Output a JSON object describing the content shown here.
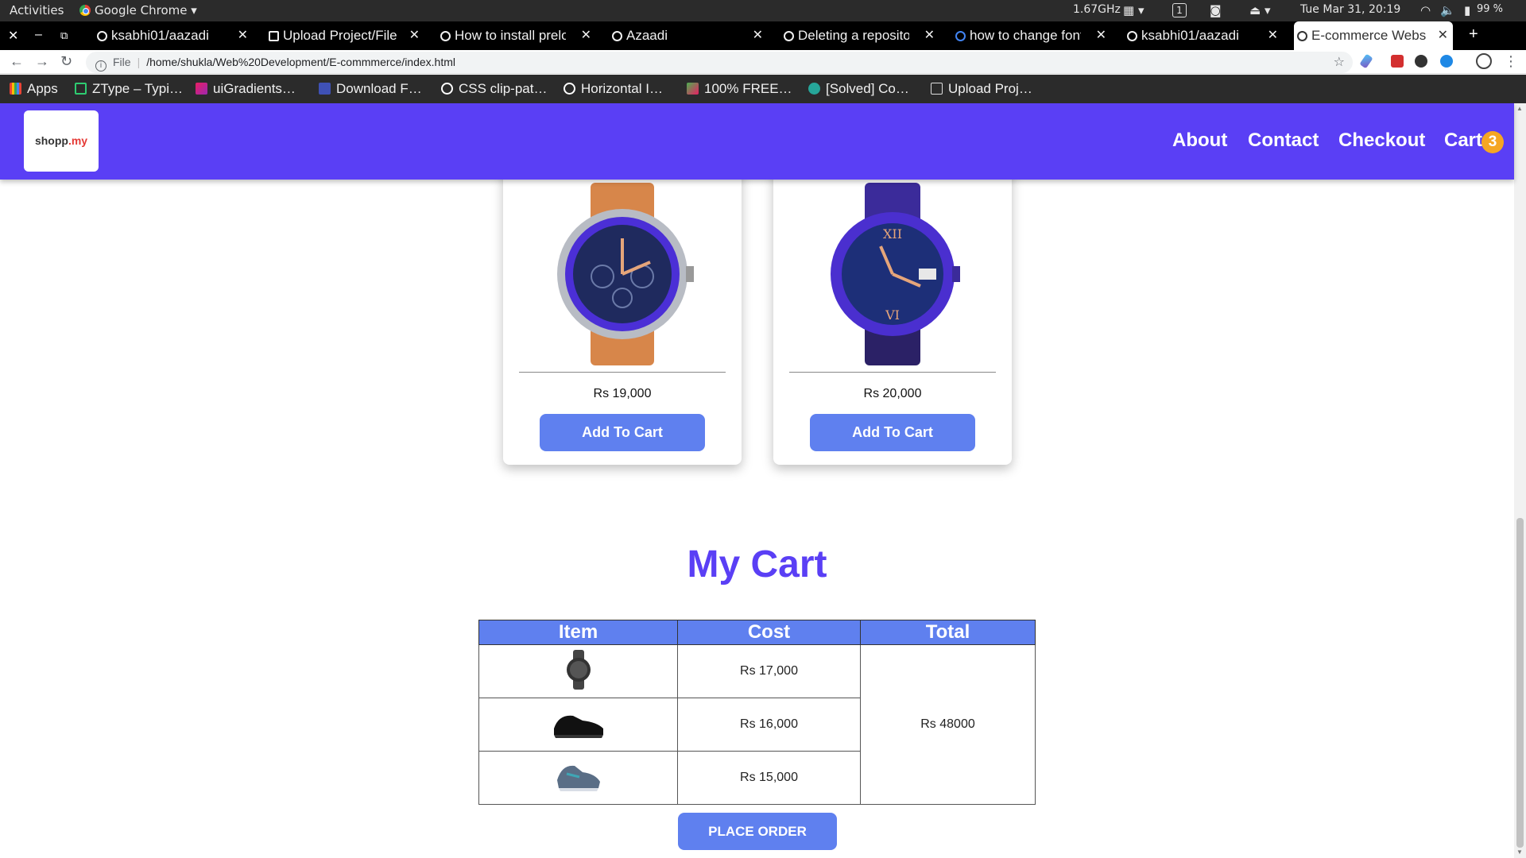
{
  "system_bar": {
    "activities": "Activities",
    "app": "Google Chrome",
    "cpu": "1.67GHz",
    "workspace": "1",
    "clock": "Tue Mar 31, 20:19",
    "battery": "99 %"
  },
  "browser": {
    "tabs": [
      {
        "label": "ksabhi01/aazadi"
      },
      {
        "label": "Upload Project/File"
      },
      {
        "label": "How to install prelo"
      },
      {
        "label": "Azaadi"
      },
      {
        "label": "Deleting a reposito"
      },
      {
        "label": "how to change font"
      },
      {
        "label": "ksabhi01/aazadi"
      },
      {
        "label": "E-commerce Websi"
      }
    ],
    "new_tab": "+",
    "scheme": "File",
    "url": "/home/shukla/Web%20Development/E-commmerce/index.html",
    "bookmarks": [
      {
        "label": "Apps"
      },
      {
        "label": "ZType – Typi…"
      },
      {
        "label": "uiGradients…"
      },
      {
        "label": "Download F…"
      },
      {
        "label": "CSS clip-pat…"
      },
      {
        "label": "Horizontal I…"
      },
      {
        "label": "100% FREE…"
      },
      {
        "label": "[Solved] Co…"
      },
      {
        "label": "Upload Proj…"
      }
    ]
  },
  "page": {
    "logo": {
      "main": "shopp",
      "accent": ".my"
    },
    "nav": {
      "about": "About",
      "contact": "Contact",
      "checkout": "Checkout",
      "cart": "Cart",
      "cart_count": "3"
    },
    "products": [
      {
        "price": "Rs 19,000",
        "button": "Add To Cart"
      },
      {
        "price": "Rs 20,000",
        "button": "Add To Cart"
      }
    ],
    "cart": {
      "title": "My Cart",
      "headers": {
        "item": "Item",
        "cost": "Cost",
        "total": "Total"
      },
      "rows": [
        {
          "cost": "Rs 17,000"
        },
        {
          "cost": "Rs 16,000"
        },
        {
          "cost": "Rs 15,000"
        }
      ],
      "total": "Rs 48000",
      "place_order": "PLACE ORDER"
    }
  },
  "colors": {
    "navbar": "#5a3ff5",
    "button": "#5f80ef",
    "badge": "#f5a623"
  }
}
